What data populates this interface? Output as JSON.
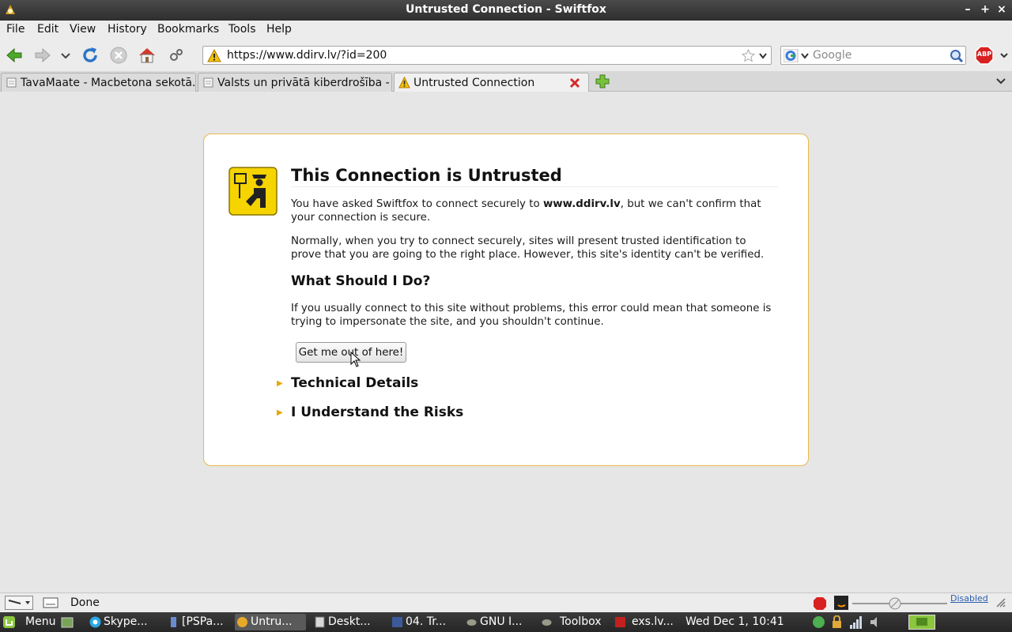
{
  "window": {
    "title": "Untrusted Connection - Swiftfox",
    "min_label": "–",
    "max_label": "+",
    "close_label": "×"
  },
  "menu": {
    "items": [
      {
        "label": "File"
      },
      {
        "label": "Edit"
      },
      {
        "label": "View"
      },
      {
        "label": "History"
      },
      {
        "label": "Bookmarks"
      },
      {
        "label": "Tools"
      },
      {
        "label": "Help"
      }
    ]
  },
  "nav": {
    "url": "https://www.ddirv.lv/?id=200",
    "search_placeholder": "Google",
    "abp_label": "ABP"
  },
  "tabs": [
    {
      "label": "TavaMaate - Macbetona sekotā..."
    },
    {
      "label": "Valsts un privātā kiberdrošība - ..."
    },
    {
      "label": "Untrusted Connection"
    }
  ],
  "error": {
    "title": "This Connection is Untrusted",
    "p1_before": "You have asked Swiftfox to connect securely to ",
    "p1_host": "www.ddirv.lv",
    "p1_after": ", but we can't confirm that your connection is secure.",
    "p2": "Normally, when you try to connect securely, sites will present trusted identification to prove that you are going to the right place. However, this site's identity can't be verified.",
    "h2": "What Should I Do?",
    "p3": "If you usually connect to this site without problems, this error could mean that someone is trying to impersonate the site, and you shouldn't continue.",
    "button": "Get me out of here!",
    "technical": "Technical Details",
    "risks": "I Understand the Risks"
  },
  "status": {
    "text": "Done",
    "disabled_label": "Disabled"
  },
  "taskbar": {
    "menu_label": "Menu",
    "items": [
      {
        "label": "Skype..."
      },
      {
        "label": "[PSPa..."
      },
      {
        "label": "Untru..."
      },
      {
        "label": "Deskt..."
      },
      {
        "label": "04. Tr..."
      },
      {
        "label": "GNU I..."
      },
      {
        "label": "Toolbox"
      },
      {
        "label": "exs.lv..."
      }
    ],
    "clock": "Wed Dec  1, 10:41"
  },
  "colors": {
    "accent_warning": "#e8b94a",
    "shield_yellow": "#f5d400",
    "link_blue": "#2a5db0"
  }
}
